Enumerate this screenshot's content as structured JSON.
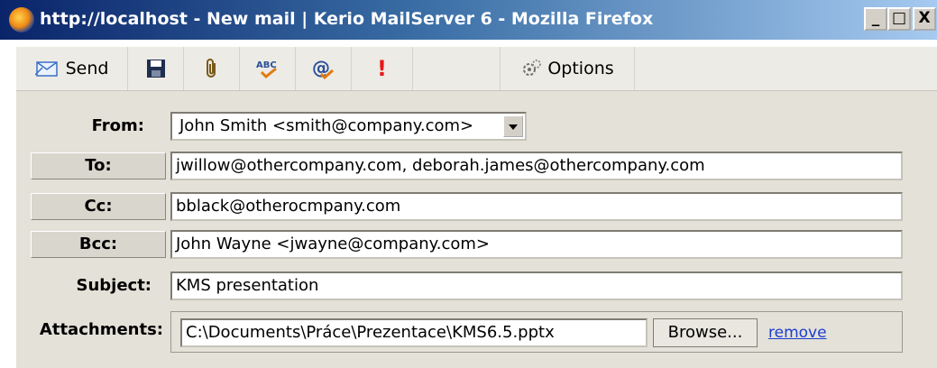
{
  "window": {
    "title": "http://localhost - New mail | Kerio MailServer 6 - Mozilla Firefox",
    "controls": [
      "_",
      "□",
      "X"
    ]
  },
  "toolbar": {
    "send_label": "Send",
    "spell_text": "ABC",
    "address_text": "@",
    "priority_text": "!",
    "options_label": "Options",
    "icons": [
      "send-envelope-icon",
      "save-disk-icon",
      "paperclip-icon",
      "spellcheck-icon",
      "address-book-icon",
      "priority-icon",
      "gear-icon"
    ]
  },
  "form": {
    "from_label": "From:",
    "from_value": "John Smith <smith@company.com>",
    "to_label": "To:",
    "to_value": "jwillow@othercompany.com, deborah.james@othercompany.com",
    "cc_label": "Cc:",
    "cc_value": "bblack@otherocmpany.com",
    "bcc_label": "Bcc:",
    "bcc_value": "John Wayne <jwayne@company.com>",
    "subject_label": "Subject:",
    "subject_value": "KMS presentation",
    "attachments_label": "Attachments:",
    "attachment_path": "C:\\Documents\\Práce\\Prezentace\\KMS6.5.pptx",
    "browse_label": "Browse...",
    "remove_label": "remove"
  },
  "colors": {
    "titlebar_start": "#0a246a",
    "titlebar_end": "#a6caf0",
    "form_background": "#e4e1d8",
    "link": "#1a3dcf",
    "priority": "#e81818"
  }
}
